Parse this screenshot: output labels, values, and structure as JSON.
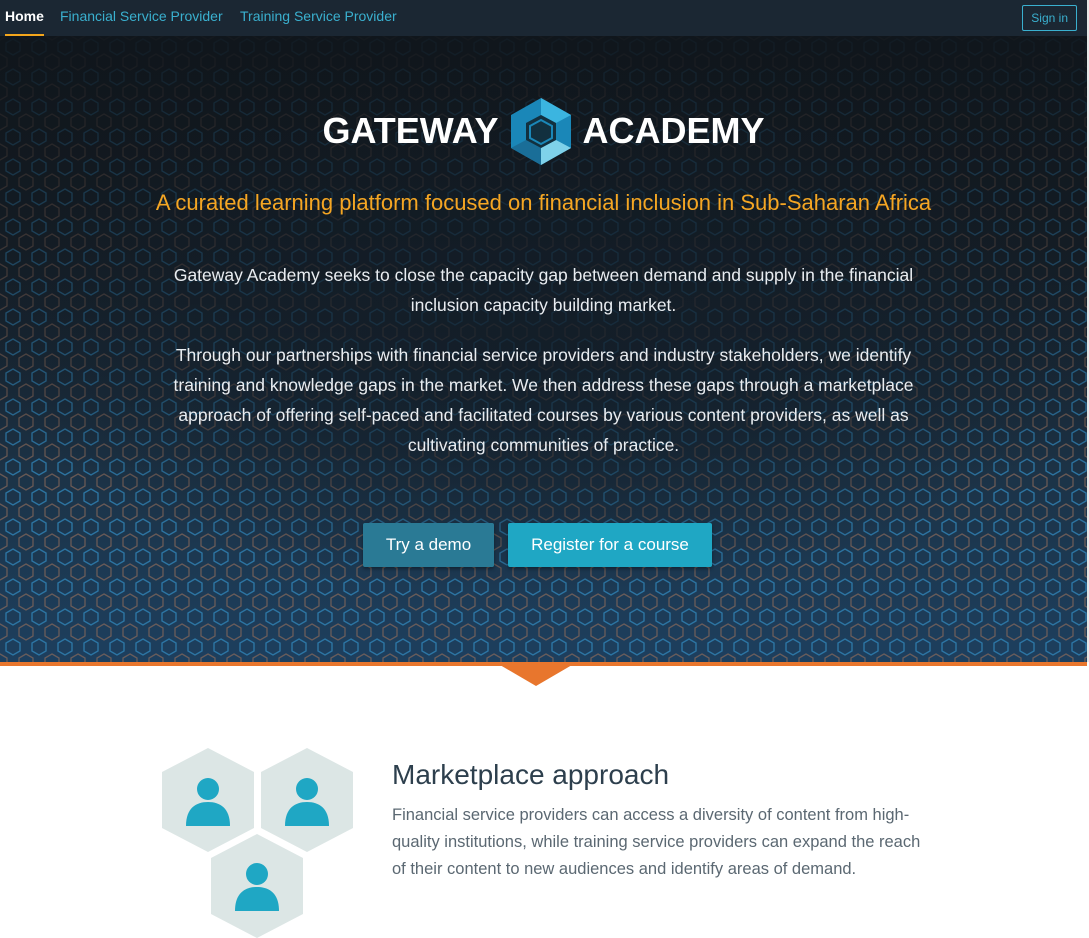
{
  "nav": {
    "items": [
      {
        "label": "Home",
        "active": true
      },
      {
        "label": "Financial Service Provider",
        "active": false
      },
      {
        "label": "Training Service Provider",
        "active": false
      }
    ],
    "signin_label": "Sign in"
  },
  "hero": {
    "logo_left": "GATEWAY",
    "logo_right": "ACADEMY",
    "tagline": "A curated learning platform focused on financial inclusion in Sub-Saharan Africa",
    "paragraph1": "Gateway Academy seeks to close the capacity gap between demand and supply in the financial inclusion capacity building market.",
    "paragraph2": "Through our partnerships with financial service providers and industry stakeholders, we identify training and knowledge gaps in the market. We then address these gaps through a marketplace approach of offering self-paced and facilitated courses by various content providers, as well as cultivating communities of practice.",
    "demo_button": "Try a demo",
    "register_button": "Register for a course"
  },
  "marketplace": {
    "title": "Marketplace approach",
    "description": "Financial service providers can access a diversity of content from high-quality institutions, while training service providers can expand the reach of their content to new audiences and identify areas of demand."
  },
  "colors": {
    "nav_bg": "#1b2733",
    "link": "#3ab0cf",
    "tagline": "#f5a623",
    "accent_orange": "#e8762d",
    "demo_button": "#2a7a95",
    "register_button": "#1fa7c4",
    "hex_bg": "#dce6e5",
    "person_icon": "#1fa7c4"
  }
}
